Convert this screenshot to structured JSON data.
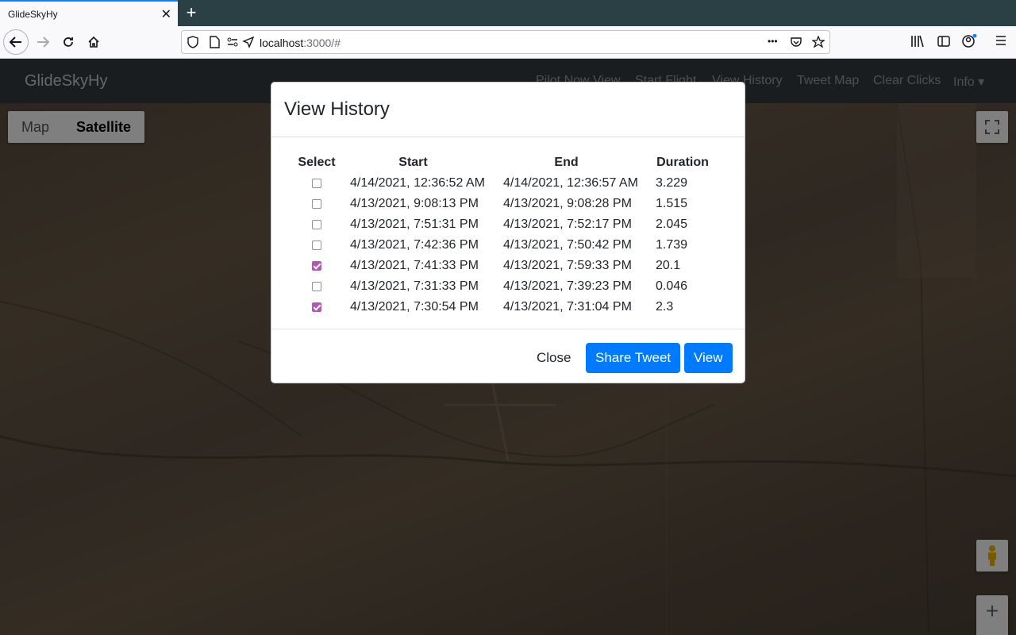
{
  "browser": {
    "tab_title": "GlideSkyHy",
    "tab_close": "✕",
    "new_tab": "+",
    "url_host": "localhost",
    "url_rest": ":3000/#",
    "more": "•••"
  },
  "app": {
    "brand": "GlideSkyHy",
    "nav": [
      "Pilot Now View",
      "Start Flight",
      "View History",
      "Tweet Map",
      "Clear Clicks",
      "Info ▾"
    ]
  },
  "map": {
    "type_buttons": [
      "Map",
      "Satellite"
    ],
    "active_type": "Satellite",
    "zoom_in": "+"
  },
  "modal": {
    "title": "View History",
    "columns": [
      "Select",
      "Start",
      "End",
      "Duration"
    ],
    "rows": [
      {
        "checked": false,
        "start": "4/14/2021, 12:36:52 AM",
        "end": "4/14/2021, 12:36:57 AM",
        "duration": "3.229"
      },
      {
        "checked": false,
        "start": "4/13/2021, 9:08:13 PM",
        "end": "4/13/2021, 9:08:28 PM",
        "duration": "1.515"
      },
      {
        "checked": false,
        "start": "4/13/2021, 7:51:31 PM",
        "end": "4/13/2021, 7:52:17 PM",
        "duration": "2.045"
      },
      {
        "checked": false,
        "start": "4/13/2021, 7:42:36 PM",
        "end": "4/13/2021, 7:50:42 PM",
        "duration": "1.739"
      },
      {
        "checked": true,
        "start": "4/13/2021, 7:41:33 PM",
        "end": "4/13/2021, 7:59:33 PM",
        "duration": "20.1"
      },
      {
        "checked": false,
        "start": "4/13/2021, 7:31:33 PM",
        "end": "4/13/2021, 7:39:23 PM",
        "duration": "0.046"
      },
      {
        "checked": true,
        "start": "4/13/2021, 7:30:54 PM",
        "end": "4/13/2021, 7:31:04 PM",
        "duration": "2.3"
      }
    ],
    "buttons": {
      "close": "Close",
      "share": "Share Tweet",
      "view": "View"
    }
  }
}
